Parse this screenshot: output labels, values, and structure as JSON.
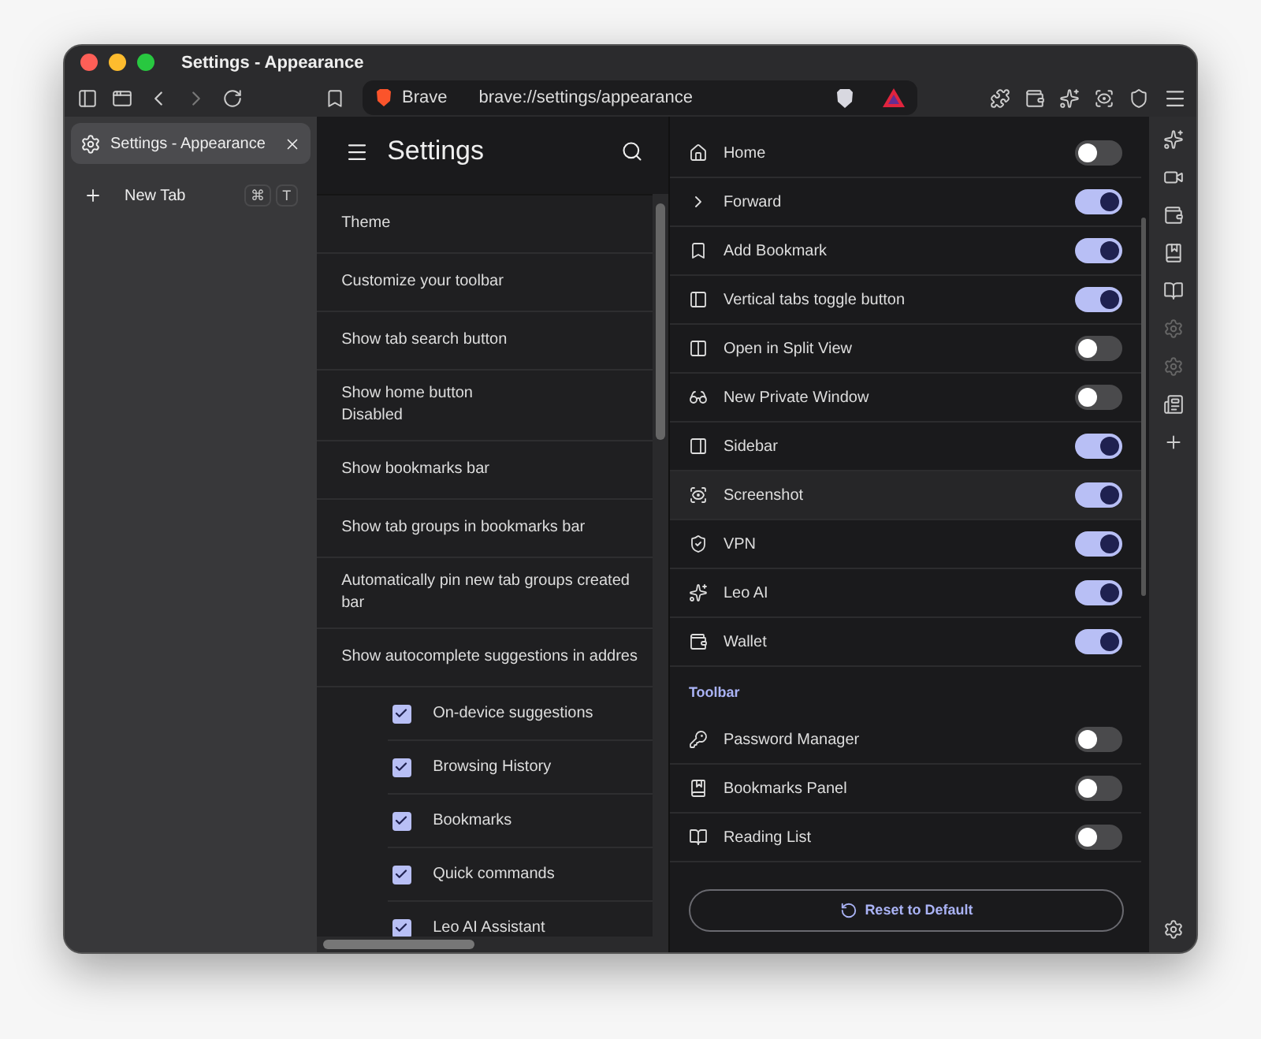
{
  "window": {
    "title": "Settings - Appearance"
  },
  "address_bar": {
    "site_label": "Brave",
    "url": "brave://settings/appearance"
  },
  "tab_strip": {
    "tabs": [
      {
        "title": "Settings - Appearance",
        "selected": true
      }
    ],
    "new_tab": {
      "label": "New Tab",
      "shortcut": [
        "⌘",
        "T"
      ]
    }
  },
  "settings_nav": {
    "title": "Settings",
    "items": [
      {
        "kind": "row",
        "lines": [
          "Theme"
        ]
      },
      {
        "kind": "row",
        "lines": [
          "Customize your toolbar"
        ]
      },
      {
        "kind": "row",
        "lines": [
          "Show tab search button"
        ]
      },
      {
        "kind": "row",
        "lines": [
          "Show home button",
          "Disabled"
        ]
      },
      {
        "kind": "row",
        "lines": [
          "Show bookmarks bar"
        ]
      },
      {
        "kind": "row",
        "lines": [
          "Show tab groups in bookmarks bar"
        ]
      },
      {
        "kind": "row",
        "lines": [
          "Automatically pin new tab groups created",
          "bar"
        ]
      },
      {
        "kind": "row",
        "lines": [
          "Show autocomplete suggestions in addres"
        ]
      },
      {
        "kind": "checkbox",
        "label": "On-device suggestions",
        "checked": true
      },
      {
        "kind": "checkbox",
        "label": "Browsing History",
        "checked": true
      },
      {
        "kind": "checkbox",
        "label": "Bookmarks",
        "checked": true
      },
      {
        "kind": "checkbox",
        "label": "Quick commands",
        "checked": true
      },
      {
        "kind": "checkbox",
        "label": "Leo AI Assistant",
        "checked": true
      }
    ]
  },
  "toolbar_settings": {
    "items": [
      {
        "kind": "toggle",
        "label": "Home",
        "on": false,
        "highlighted": false
      },
      {
        "kind": "toggle",
        "label": "Forward",
        "on": true,
        "highlighted": false
      },
      {
        "kind": "toggle",
        "label": "Add Bookmark",
        "on": true,
        "highlighted": false
      },
      {
        "kind": "toggle",
        "label": "Vertical tabs toggle button",
        "on": true,
        "highlighted": false
      },
      {
        "kind": "toggle",
        "label": "Open in Split View",
        "on": false,
        "highlighted": false
      },
      {
        "kind": "toggle",
        "label": "New Private Window",
        "on": false,
        "highlighted": false
      },
      {
        "kind": "toggle",
        "label": "Sidebar",
        "on": true,
        "highlighted": false
      },
      {
        "kind": "toggle",
        "label": "Screenshot",
        "on": true,
        "highlighted": true
      },
      {
        "kind": "toggle",
        "label": "VPN",
        "on": true,
        "highlighted": false
      },
      {
        "kind": "toggle",
        "label": "Leo AI",
        "on": true,
        "highlighted": false
      },
      {
        "kind": "toggle",
        "label": "Wallet",
        "on": true,
        "highlighted": false
      },
      {
        "kind": "header",
        "label": "Toolbar"
      },
      {
        "kind": "toggle",
        "label": "Password Manager",
        "on": false,
        "highlighted": false
      },
      {
        "kind": "toggle",
        "label": "Bookmarks Panel",
        "on": false,
        "highlighted": false
      },
      {
        "kind": "toggle",
        "label": "Reading List",
        "on": false,
        "highlighted": false
      }
    ],
    "reset_button": "Reset to Default"
  }
}
